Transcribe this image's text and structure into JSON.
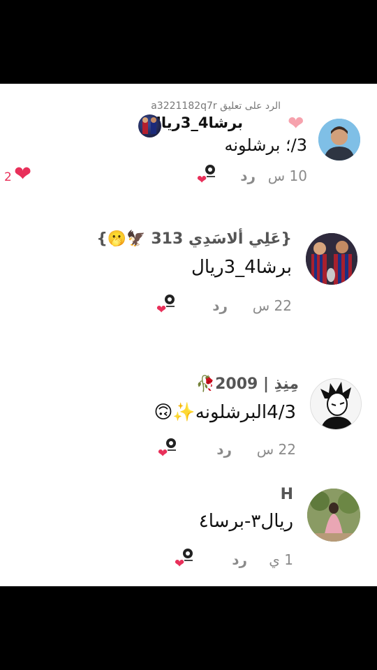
{
  "reply_header": {
    "reply_to_text": "الرد على تعليق a3221182q7r",
    "quoted_comment": "برشا4_3ريال"
  },
  "comments": [
    {
      "text": "3/؛ برشلونه",
      "time": "10 س",
      "reply_label": "رد",
      "like_count": "2"
    },
    {
      "username": "{عَلِي ألاسَدِي 313 🦅🫢}",
      "text": "برشا4_3ريال",
      "time": "22 س",
      "reply_label": "رد"
    },
    {
      "username": "مِنِذِ | 2009🥀",
      "text": "4/3البرشلونه✨🙃",
      "time": "22 س",
      "reply_label": "رد"
    },
    {
      "username": "H",
      "text": "ريال٣-برسا٤",
      "time": "1 ي",
      "reply_label": "رد"
    }
  ],
  "colors": {
    "heart": "#e8305a",
    "faded_heart": "#f6a2ad",
    "muted_text": "#8a8a8a"
  },
  "icons": [
    "heart-icon",
    "sticker-icon"
  ]
}
